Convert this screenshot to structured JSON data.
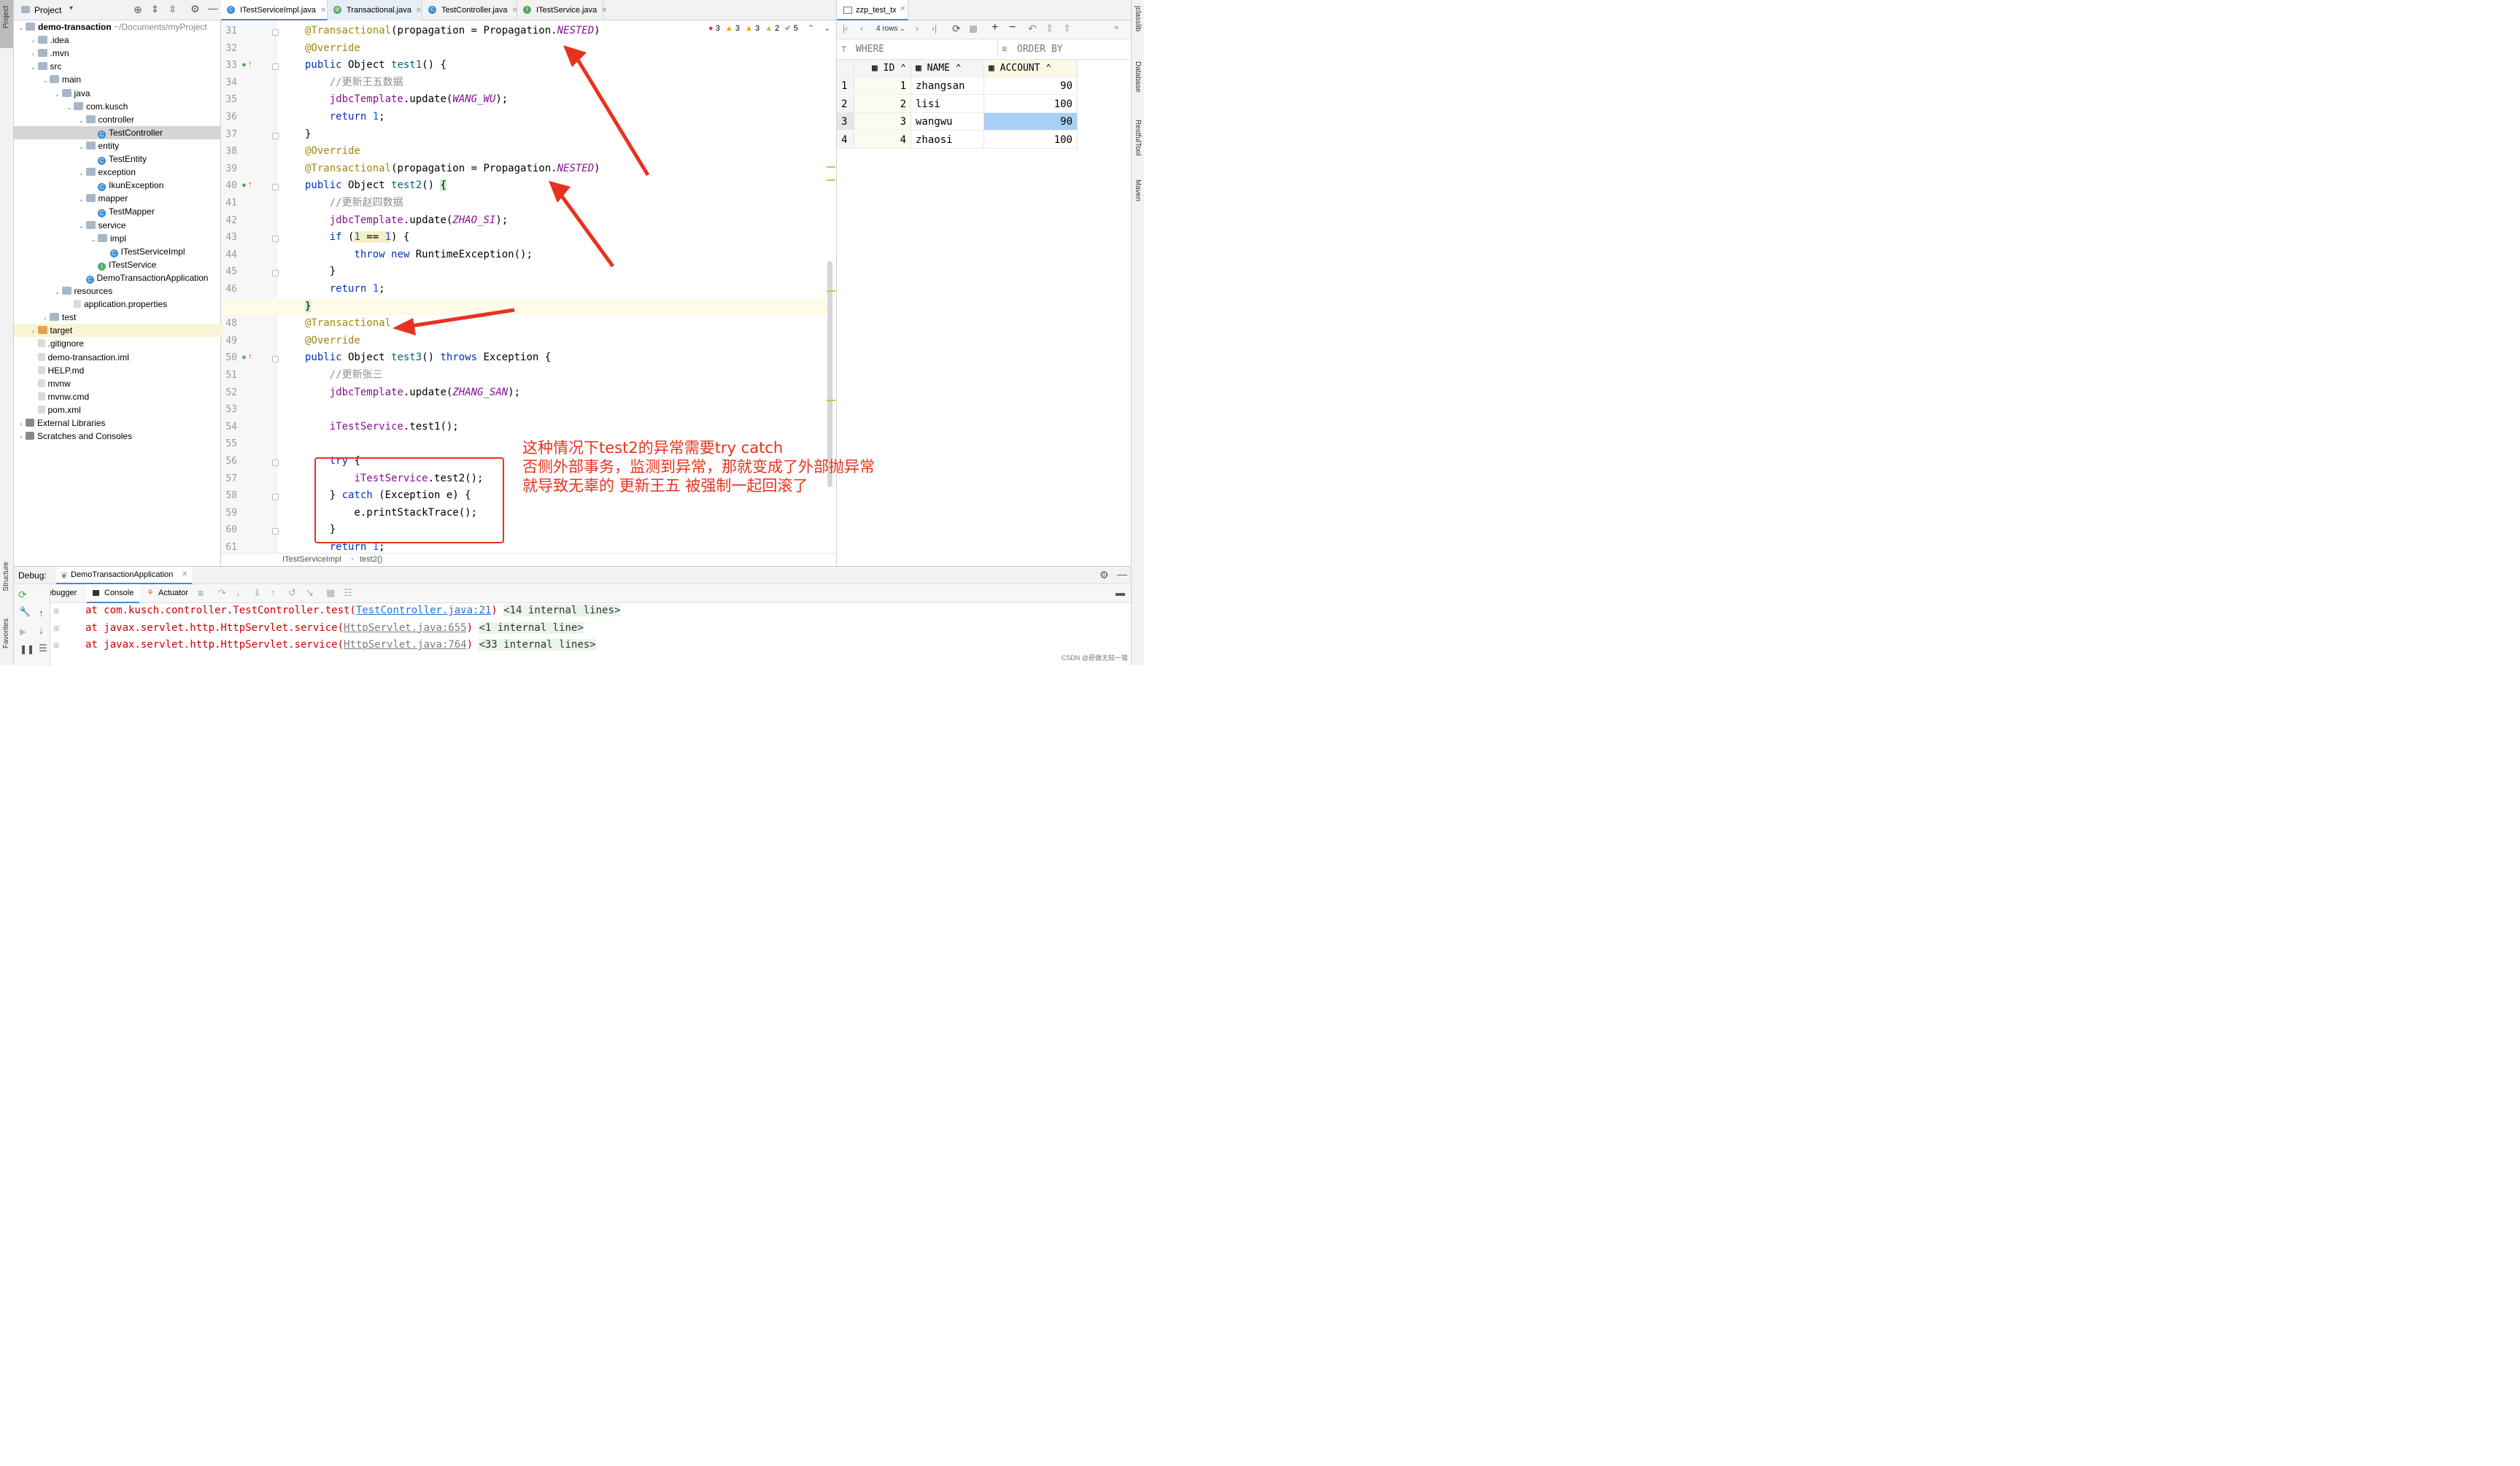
{
  "left_stripe": {
    "project": "Project",
    "structure": "Structure",
    "favorites": "Favorites"
  },
  "project_panel": {
    "title": "Project",
    "tree": [
      {
        "label": "demo-transaction",
        "extra": "~/Documents/myProject",
        "depth": 0,
        "icon": "folder",
        "open": true,
        "bold": true
      },
      {
        "label": ".idea",
        "depth": 1,
        "icon": "folder",
        "open": false
      },
      {
        "label": ".mvn",
        "depth": 1,
        "icon": "folder",
        "open": false
      },
      {
        "label": "src",
        "depth": 1,
        "icon": "folder",
        "open": true
      },
      {
        "label": "main",
        "depth": 2,
        "icon": "folder",
        "open": true
      },
      {
        "label": "java",
        "depth": 3,
        "icon": "folder",
        "open": true
      },
      {
        "label": "com.kusch",
        "depth": 4,
        "icon": "pkg",
        "open": true
      },
      {
        "label": "controller",
        "depth": 5,
        "icon": "pkg",
        "open": true
      },
      {
        "label": "TestController",
        "depth": 6,
        "icon": "cls",
        "selected": true
      },
      {
        "label": "entity",
        "depth": 5,
        "icon": "pkg",
        "open": true
      },
      {
        "label": "TestEntity",
        "depth": 6,
        "icon": "cls"
      },
      {
        "label": "exception",
        "depth": 5,
        "icon": "pkg",
        "open": true
      },
      {
        "label": "IkunException",
        "depth": 6,
        "icon": "cls"
      },
      {
        "label": "mapper",
        "depth": 5,
        "icon": "pkg",
        "open": true
      },
      {
        "label": "TestMapper",
        "depth": 6,
        "icon": "cls"
      },
      {
        "label": "service",
        "depth": 5,
        "icon": "pkg",
        "open": true
      },
      {
        "label": "impl",
        "depth": 6,
        "icon": "pkg",
        "open": true
      },
      {
        "label": "ITestServiceImpl",
        "depth": 7,
        "icon": "cls"
      },
      {
        "label": "ITestService",
        "depth": 6,
        "icon": "itf"
      },
      {
        "label": "DemoTransactionApplication",
        "depth": 5,
        "icon": "cls"
      },
      {
        "label": "resources",
        "depth": 3,
        "icon": "folder",
        "open": true
      },
      {
        "label": "application.properties",
        "depth": 4,
        "icon": "file"
      },
      {
        "label": "test",
        "depth": 2,
        "icon": "folder",
        "open": false
      },
      {
        "label": "target",
        "depth": 1,
        "icon": "folder-o",
        "open": false,
        "target": true
      },
      {
        "label": ".gitignore",
        "depth": 1,
        "icon": "file"
      },
      {
        "label": "demo-transaction.iml",
        "depth": 1,
        "icon": "file"
      },
      {
        "label": "HELP.md",
        "depth": 1,
        "icon": "file"
      },
      {
        "label": "mvnw",
        "depth": 1,
        "icon": "file"
      },
      {
        "label": "mvnw.cmd",
        "depth": 1,
        "icon": "file"
      },
      {
        "label": "pom.xml",
        "depth": 1,
        "icon": "file"
      },
      {
        "label": "External Libraries",
        "depth": 0,
        "icon": "lib",
        "open": false
      },
      {
        "label": "Scratches and Consoles",
        "depth": 0,
        "icon": "lib",
        "open": false
      }
    ]
  },
  "tabs": [
    {
      "label": "ITestServiceImpl.java",
      "icon": "C",
      "color": "#3a8ed9",
      "active": true
    },
    {
      "label": "Transactional.java",
      "icon": "@",
      "color": "#59a869",
      "focus": true
    },
    {
      "label": "TestController.java",
      "icon": "C",
      "color": "#3a8ed9"
    },
    {
      "label": "ITestService.java",
      "icon": "I",
      "color": "#59a869"
    }
  ],
  "inspections": {
    "errors": "3",
    "warn1": "3",
    "warn2": "3",
    "weak": "2",
    "ok": "5"
  },
  "code_lines": [
    {
      "n": "31",
      "html": "<span class='ann'>@Transactional</span>(propagation = Propagation.<span class='cst'>NESTED</span>)"
    },
    {
      "n": "32",
      "html": "<span class='ann'>@Override</span>"
    },
    {
      "n": "33",
      "html": "<span class='kw'>public</span> Object <span class='fn'>test1</span>() {"
    },
    {
      "n": "34",
      "html": "    <span class='cm'>//更新王五数据</span>"
    },
    {
      "n": "35",
      "html": "    <span class='ref'>jdbcTemplate</span>.update(<span class='cst'>WANG_WU</span>);"
    },
    {
      "n": "36",
      "html": "    <span class='kw'>return</span> <span class='num'>1</span>;"
    },
    {
      "n": "37",
      "html": "}"
    },
    {
      "n": "38",
      "html": "<span class='ann'>@Override</span>"
    },
    {
      "n": "39",
      "html": "<span class='ann'>@Transactional</span>(propagation = Propagation.<span class='cst'>NESTED</span>)"
    },
    {
      "n": "40",
      "html": "<span class='kw'>public</span> Object <span class='fn'>test2</span>() <span style='background:#c9f0d4'>{</span>"
    },
    {
      "n": "41",
      "html": "    <span class='cm'>//更新赵四数据</span>"
    },
    {
      "n": "42",
      "html": "    <span class='ref'>jdbcTemplate</span>.update(<span class='cst'>ZHAO_SI</span>);"
    },
    {
      "n": "43",
      "html": "    <span class='kw'>if</span> (<span style='background:#f4efc4'><span class='num'>1</span> == <span class='num'>1</span></span>) {"
    },
    {
      "n": "44",
      "html": "        <span class='kw'>throw new</span> RuntimeException();"
    },
    {
      "n": "45",
      "html": "    }"
    },
    {
      "n": "46",
      "html": "    <span class='kw'>return</span> <span class='num'>1</span>;"
    },
    {
      "n": "47",
      "html": "<span style='background:#c9f0d4'>}</span>"
    },
    {
      "n": "48",
      "html": "<span class='ann'>@Transactional</span>"
    },
    {
      "n": "49",
      "html": "<span class='ann'>@Override</span>"
    },
    {
      "n": "50",
      "html": "<span class='kw'>public</span> Object <span class='fn'>test3</span>() <span class='kw'>throws</span> Exception {"
    },
    {
      "n": "51",
      "html": "    <span class='cm'>//更新张三</span>"
    },
    {
      "n": "52",
      "html": "    <span class='ref'>jdbcTemplate</span>.update(<span class='cst'>ZHANG_SAN</span>);"
    },
    {
      "n": "53",
      "html": ""
    },
    {
      "n": "54",
      "html": "    <span class='ref'>iTestService</span>.test1();"
    },
    {
      "n": "55",
      "html": ""
    },
    {
      "n": "56",
      "html": "    <span class='kw'>try</span> {"
    },
    {
      "n": "57",
      "html": "        <span class='ref'>iTestService</span>.test2();"
    },
    {
      "n": "58",
      "html": "    } <span class='kw'>catch</span> (Exception e) {"
    },
    {
      "n": "59",
      "html": "        e.printStackTrace();"
    },
    {
      "n": "60",
      "html": "    }"
    },
    {
      "n": "61",
      "html": "    <span class='kw'>return</span> <span class='num'>1</span>;"
    }
  ],
  "breadcrumb": {
    "a": "ITestServiceImpl",
    "b": "test2()"
  },
  "db": {
    "tab": "zzp_test_tx",
    "rows_label": "4 rows",
    "where": "WHERE",
    "order": "ORDER BY",
    "columns": [
      "ID",
      "NAME",
      "ACCOUNT"
    ],
    "rows": [
      [
        "1",
        "1",
        "zhangsan",
        "90"
      ],
      [
        "2",
        "2",
        "lisi",
        "100"
      ],
      [
        "3",
        "3",
        "wangwu",
        "90"
      ],
      [
        "4",
        "4",
        "zhaosi",
        "100"
      ]
    ]
  },
  "right_stripe": {
    "a": "jclasslib",
    "b": "Database",
    "c": "RestfulTool",
    "d": "Maven"
  },
  "debug": {
    "title": "Debug:",
    "run": "DemoTransactionApplication",
    "tabs": [
      "Debugger",
      "Console",
      "Actuator"
    ],
    "lines": [
      {
        "pre": "at com.kusch.controller.TestController.test(",
        "link": "TestController.java:21",
        "post": ")",
        "lines": "<14 internal lines>"
      },
      {
        "pre": "at javax.servlet.http.HttpServlet.service(",
        "link": "HttpServlet.java:655",
        "post": ")",
        "lines": "<1 internal line>"
      },
      {
        "pre": "at javax.servlet.http.HttpServlet.service(",
        "link": "HttpServlet.java:764",
        "post": ")",
        "lines": "<33 internal lines>"
      }
    ]
  },
  "annotation": {
    "line1": "这种情况下test2的异常需要try catch",
    "line2": "否侧外部事务，监测到异常，那就变成了外部抛异常",
    "line3": "就导致无辜的 更新王五 被强制一起回滚了"
  },
  "watermark": "CSDN @愿做无知一猿",
  "colors": {
    "accent": "#e8321f",
    "selection": "#a9cff5"
  }
}
